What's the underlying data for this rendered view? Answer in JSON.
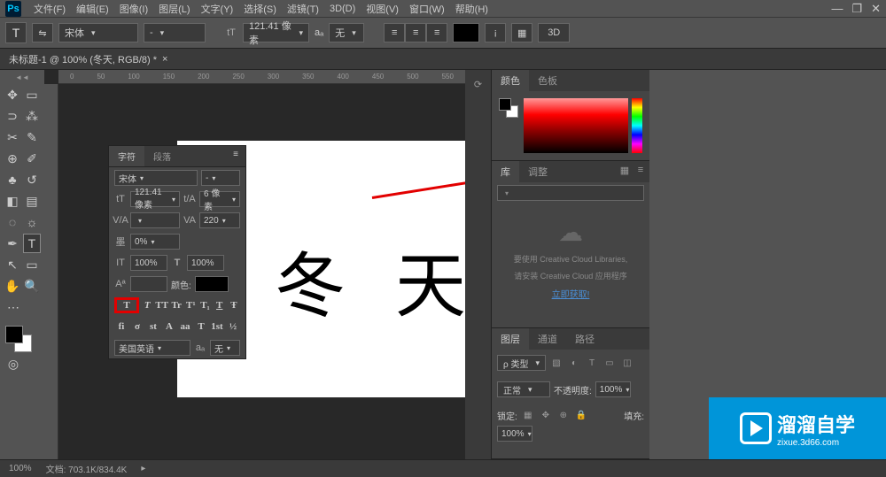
{
  "app": {
    "logo": "Ps"
  },
  "menubar": {
    "items": [
      "文件(F)",
      "编辑(E)",
      "图像(I)",
      "图层(L)",
      "文字(Y)",
      "选择(S)",
      "滤镜(T)",
      "3D(D)",
      "视图(V)",
      "窗口(W)",
      "帮助(H)"
    ]
  },
  "options_bar": {
    "font_family": "宋体",
    "font_style": "-",
    "font_size": "121.41 像素",
    "aa_label": "aₐ",
    "aa_method": "无",
    "btn_3d": "3D"
  },
  "document_tab": {
    "title": "未标题-1 @ 100% (冬天, RGB/8) *"
  },
  "canvas": {
    "text": "冬 天"
  },
  "ruler_marks": [
    "0",
    "50",
    "100",
    "150",
    "200",
    "250",
    "300",
    "350",
    "400",
    "450",
    "500",
    "550"
  ],
  "character_panel": {
    "tabs": [
      "字符",
      "段落"
    ],
    "font_family": "宋体",
    "font_style": "-",
    "tt_label": "tT",
    "font_size": "121.41 像素",
    "leading_label": "t/A",
    "leading": "6 像素",
    "va_label": "V/A",
    "va_value": "",
    "vav_label": "VA",
    "vav_value": "220",
    "scale_label": "墨",
    "scale_value": "0%",
    "it_label": "IT",
    "it_value": "100%",
    "T_label": "T",
    "T_value": "100%",
    "baseline_label": "Aª",
    "color_label": "颜色:",
    "style_btns": [
      "T",
      "T",
      "TT",
      "Tr",
      "T¹",
      "T₁",
      "T",
      "Ŧ"
    ],
    "fi_btns": [
      "fi",
      "σ",
      "st",
      "A",
      "aa",
      "T",
      "1st",
      "½"
    ],
    "language": "美国英语",
    "aa_label2": "aₐ",
    "aa_method": "无"
  },
  "color_panel": {
    "tabs": [
      "颜色",
      "色板"
    ]
  },
  "libraries_panel": {
    "tabs": [
      "库",
      "调整"
    ],
    "line1": "要使用 Creative Cloud Libraries,",
    "line2": "请安装 Creative Cloud 应用程序",
    "link": "立即获取!"
  },
  "layers_panel": {
    "tabs": [
      "图层",
      "通道",
      "路径"
    ],
    "type_filter": "ρ 类型",
    "blend_mode": "正常",
    "opacity_label": "不透明度:",
    "opacity_value": "100%",
    "lock_label": "锁定:",
    "fill_label": "填充:",
    "fill_value": "100%"
  },
  "statusbar": {
    "zoom": "100%",
    "doc_info": "文档: 703.1K/834.4K"
  },
  "watermark": {
    "main": "溜溜自学",
    "sub": "zixue.3d66.com"
  }
}
